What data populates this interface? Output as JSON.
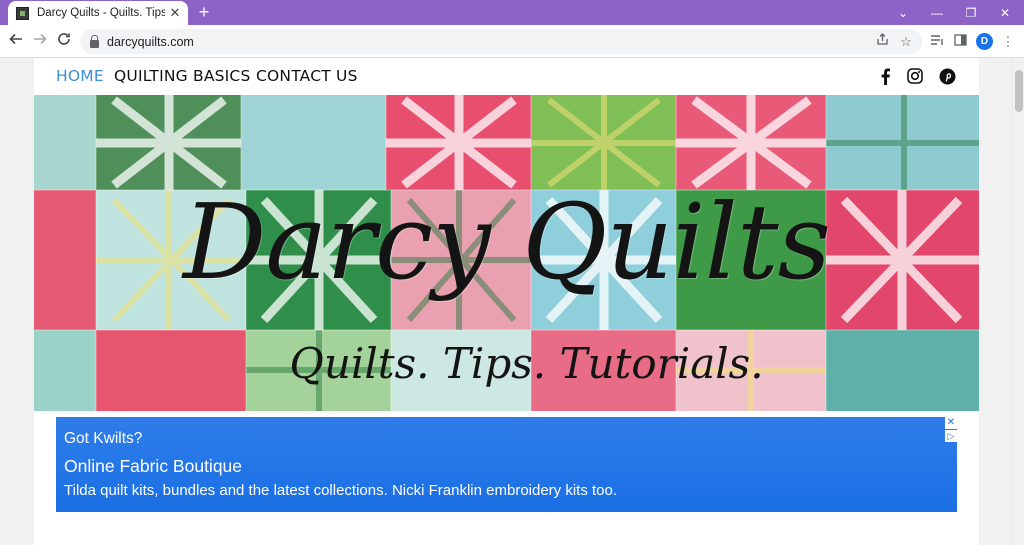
{
  "browser": {
    "tab_title": "Darcy Quilts - Quilts. Tips. Tutorials.",
    "tab_close": "✕",
    "new_tab": "+",
    "url": "darcyquilts.com",
    "profile_initial": "D",
    "window_controls": {
      "minimize": "—",
      "restore": "❐",
      "close": "✕",
      "tab_search": "⌄"
    }
  },
  "site": {
    "nav": [
      {
        "label": "HOME",
        "active": true
      },
      {
        "label": "QUILTING BASICS",
        "active": false
      },
      {
        "label": "CONTACT US",
        "active": false
      }
    ],
    "social_icons": [
      "facebook-icon",
      "instagram-icon",
      "pinterest-icon"
    ],
    "banner": {
      "title": "Darcy Quilts",
      "tagline": "Quilts. Tips. Tutorials."
    },
    "ad": {
      "kicker": "Got Kwilts?",
      "title": "Online Fabric Boutique",
      "description": "Tilda quilt kits, bundles and the latest collections. Nicki Franklin embroidery kits too.",
      "close": "✕",
      "choices": "▷"
    }
  },
  "colors": {
    "tab_strip": "#8e63c7",
    "nav_active": "#3a8fd6",
    "ad_background": "#1a73e8"
  }
}
